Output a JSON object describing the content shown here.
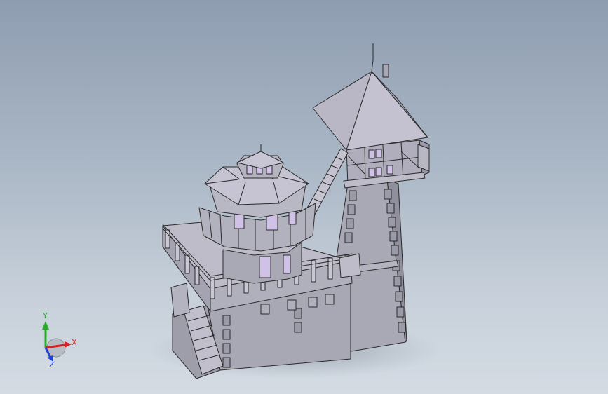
{
  "triad": {
    "x_label": "X",
    "y_label": "Y",
    "z_label": "Z",
    "colors": {
      "x": "#d42020",
      "y": "#20b020",
      "z": "#2040d0"
    }
  },
  "model": {
    "colors": {
      "wall": "#a8a8b4",
      "wall_dark": "#8e8e9c",
      "roof": "#b8b6c4",
      "roof_dark": "#9a98a8",
      "window": "#c8b8e0",
      "edge": "#2a2a2a"
    }
  }
}
